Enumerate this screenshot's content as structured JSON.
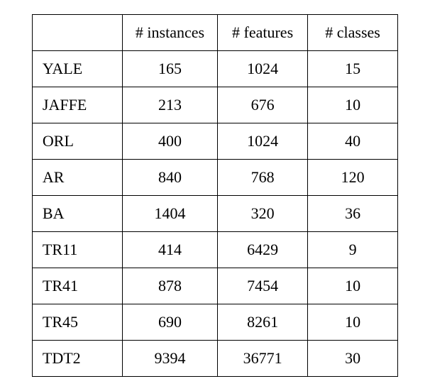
{
  "chart_data": {
    "type": "table",
    "headers": [
      "# instances",
      "# features",
      "# classes"
    ],
    "rows": [
      {
        "name": "YALE",
        "instances": 165,
        "features": 1024,
        "classes": 15
      },
      {
        "name": "JAFFE",
        "instances": 213,
        "features": 676,
        "classes": 10
      },
      {
        "name": "ORL",
        "instances": 400,
        "features": 1024,
        "classes": 40
      },
      {
        "name": "AR",
        "instances": 840,
        "features": 768,
        "classes": 120
      },
      {
        "name": "BA",
        "instances": 1404,
        "features": 320,
        "classes": 36
      },
      {
        "name": "TR11",
        "instances": 414,
        "features": 6429,
        "classes": 9
      },
      {
        "name": "TR41",
        "instances": 878,
        "features": 7454,
        "classes": 10
      },
      {
        "name": "TR45",
        "instances": 690,
        "features": 8261,
        "classes": 10
      },
      {
        "name": "TDT2",
        "instances": 9394,
        "features": 36771,
        "classes": 30
      }
    ]
  }
}
